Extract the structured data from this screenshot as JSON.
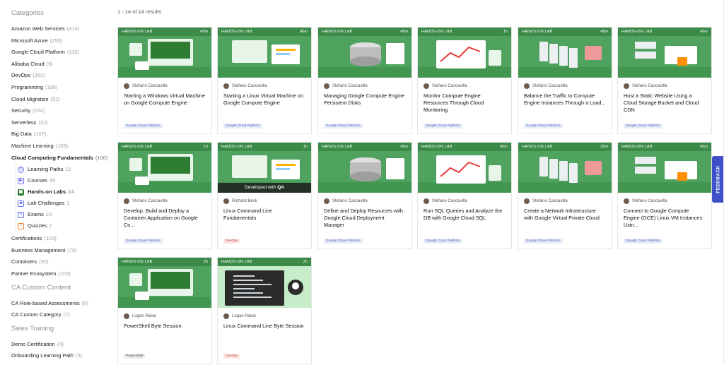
{
  "sidebar": {
    "categories_title": "Categories",
    "categories": [
      {
        "label": "Amazon Web Services",
        "count": "(416)"
      },
      {
        "label": "Microsoft Azure",
        "count": "(255)"
      },
      {
        "label": "Google Cloud Platform",
        "count": "(115)"
      },
      {
        "label": "Alibaba Cloud",
        "count": "(5)"
      },
      {
        "label": "DevOps",
        "count": "(263)"
      },
      {
        "label": "Programming",
        "count": "(195)"
      },
      {
        "label": "Cloud Migration",
        "count": "(52)"
      },
      {
        "label": "Security",
        "count": "(234)"
      },
      {
        "label": "Serverless",
        "count": "(32)"
      },
      {
        "label": "Big Data",
        "count": "(107)"
      },
      {
        "label": "Machine Learning",
        "count": "(105)"
      },
      {
        "label": "Cloud Computing Fundamentals",
        "count": "(100)"
      }
    ],
    "sub_items": [
      {
        "label": "Learning Paths",
        "count": "15"
      },
      {
        "label": "Courses",
        "count": "45"
      },
      {
        "label": "Hands-on Labs",
        "count": "14"
      },
      {
        "label": "Lab Challenges",
        "count": "1"
      },
      {
        "label": "Exams",
        "count": "23"
      },
      {
        "label": "Quizzes",
        "count": "2"
      }
    ],
    "categories_after": [
      {
        "label": "Certifications",
        "count": "(103)"
      },
      {
        "label": "Business Management",
        "count": "(70)"
      },
      {
        "label": "Containers",
        "count": "(92)"
      },
      {
        "label": "Partner Ecosystem",
        "count": "(103)"
      }
    ],
    "custom_title": "CA Custom Content",
    "custom": [
      {
        "label": "CA Role-based Assessments",
        "count": "(5)"
      },
      {
        "label": "CA Custom Category",
        "count": "(7)"
      }
    ],
    "sales_title": "Sales Training",
    "sales": [
      {
        "label": "Demo Certification",
        "count": "(4)"
      },
      {
        "label": "Onboarding Learning Path",
        "count": "(5)"
      }
    ]
  },
  "results_text": "1 - 14 of 14 results",
  "lab_label": "HANDS-ON LAB",
  "overlay": {
    "prefix": "Developed with",
    "brand": "QA"
  },
  "feedback_label": "FEEDBACK",
  "cards": [
    {
      "duration": "45m",
      "author": "Stefano Cascavilla",
      "title": "Starting a Windows Virtual Machine on Google Compute Engine",
      "tag": "Google Cloud Platform"
    },
    {
      "duration": "45m",
      "author": "Stefano Cascavilla",
      "title": "Starting a Linux Virtual Machine on Google Compute Engine",
      "tag": "Google Cloud Platform"
    },
    {
      "duration": "45m",
      "author": "Stefano Cascavilla",
      "title": "Managing Google Compute Engine Persistent Disks",
      "tag": "Google Cloud Platform"
    },
    {
      "duration": "1h",
      "author": "Stefano Cascavilla",
      "title": "Monitor Compute Engine Resources Through Cloud Monitoring",
      "tag": "Google Cloud Platform"
    },
    {
      "duration": "45m",
      "author": "Stefano Cascavilla",
      "title": "Balance the Traffic to Compute Engine Instances Through a Load...",
      "tag": "Google Cloud Platform"
    },
    {
      "duration": "45m",
      "author": "Stefano Cascavilla",
      "title": "Host a Static Website Using a Cloud Storage Bucket and Cloud CDN",
      "tag": "Google Cloud Platform"
    },
    {
      "duration": "1h",
      "author": "Stefano Cascavilla",
      "title": "Develop, Build and Deploy a Container Application on Google Co...",
      "tag": "Google Cloud Platform"
    },
    {
      "duration": "1h",
      "author": "Richard Beck",
      "title": "Linux Command Line Fundamentals",
      "tag": "DevOps"
    },
    {
      "duration": "45m",
      "author": "Stefano Cascavilla",
      "title": "Define and Deploy Resources with Google Cloud Deployment Manager",
      "tag": "Google Cloud Platform"
    },
    {
      "duration": "45m",
      "author": "Stefano Cascavilla",
      "title": "Run SQL Queries and Analyze the DB with Google Cloud SQL",
      "tag": "Google Cloud Platform"
    },
    {
      "duration": "30m",
      "author": "Stefano Cascavilla",
      "title": "Create a Network Infrastructure with Google Virtual Private Cloud",
      "tag": "Google Cloud Platform"
    },
    {
      "duration": "45m",
      "author": "Stefano Cascavilla",
      "title": "Connect to Google Compute Engine (GCE) Linux VM Instances Usin...",
      "tag": "Google Cloud Platform"
    },
    {
      "duration": "2h",
      "author": "Logan Rakai",
      "title": "PowerShell Byte Session",
      "tag": "PowerShell"
    },
    {
      "duration": "2h",
      "author": "Logan Rakai",
      "title": "Linux Command Line Byte Session",
      "tag": "DevOps"
    }
  ]
}
